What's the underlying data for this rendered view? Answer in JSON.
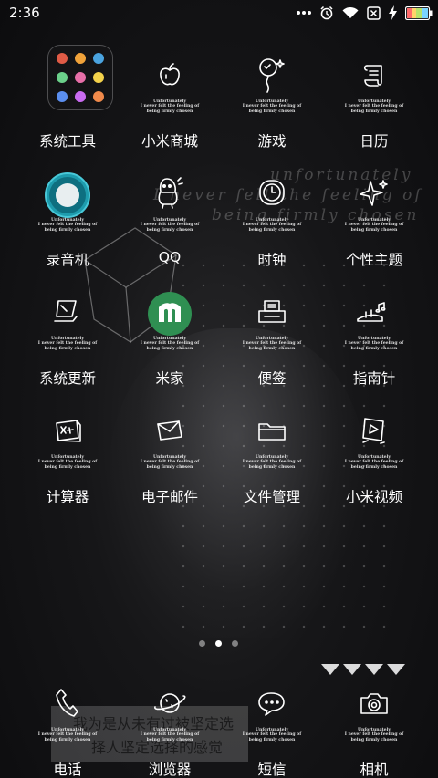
{
  "status_bar": {
    "time": "2:36",
    "icons": [
      "more-dots-icon",
      "alarm-icon",
      "wifi-icon",
      "no-sim-icon",
      "charging-icon",
      "battery-icon"
    ]
  },
  "caption_lines": [
    "Unfortunately",
    "I never felt the feeling of",
    "being firmly chosen"
  ],
  "wallpaper": {
    "line1": "unfortunately",
    "line2": "I never felt the feeling of",
    "line3": "being firmly chosen",
    "cn_line1": "我为是从未有过被坚定选",
    "cn_line2": "择人坚定选择的感觉"
  },
  "apps": [
    {
      "label": "系统工具",
      "icon": "folder-icon"
    },
    {
      "label": "小米商城",
      "icon": "apple-icon"
    },
    {
      "label": "游戏",
      "icon": "balloon-icon"
    },
    {
      "label": "日历",
      "icon": "calendar-scroll-icon"
    },
    {
      "label": "录音机",
      "icon": "recorder-icon"
    },
    {
      "label": "QQ",
      "icon": "penguin-icon"
    },
    {
      "label": "时钟",
      "icon": "clock-icon"
    },
    {
      "label": "个性主题",
      "icon": "sparkle-icon"
    },
    {
      "label": "系统更新",
      "icon": "laptop-icon"
    },
    {
      "label": "米家",
      "icon": "mijia-icon"
    },
    {
      "label": "便签",
      "icon": "notepad-icon"
    },
    {
      "label": "指南针",
      "icon": "compass-icon"
    },
    {
      "label": "计算器",
      "icon": "calculator-icon"
    },
    {
      "label": "电子邮件",
      "icon": "envelope-icon"
    },
    {
      "label": "文件管理",
      "icon": "folder-file-icon"
    },
    {
      "label": "小米视频",
      "icon": "video-icon"
    }
  ],
  "dock": [
    {
      "label": "电话",
      "icon": "phone-icon"
    },
    {
      "label": "浏览器",
      "icon": "planet-icon"
    },
    {
      "label": "短信",
      "icon": "chat-bubble-icon"
    },
    {
      "label": "相机",
      "icon": "camera-icon"
    }
  ],
  "pager": {
    "pages": 3,
    "active": 2
  },
  "colors": {
    "mijia_green": "#2f8f52",
    "recorder_teal": "#1fa3b5",
    "battery_fill": "#b5e36a"
  }
}
